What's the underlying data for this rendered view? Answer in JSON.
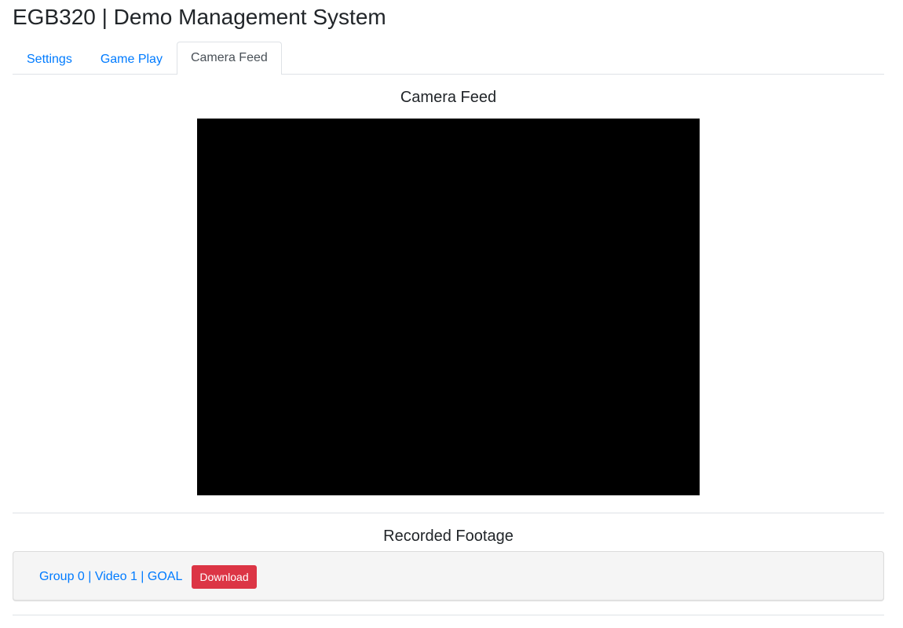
{
  "header": {
    "title": "EGB320 | Demo Management System"
  },
  "tabs": [
    {
      "label": "Settings",
      "active": false
    },
    {
      "label": "Game Play",
      "active": false
    },
    {
      "label": "Camera Feed",
      "active": true
    }
  ],
  "camera": {
    "heading": "Camera Feed",
    "feed_color": "#000000"
  },
  "footage": {
    "heading": "Recorded Footage",
    "items": [
      {
        "label": "Group 0 | Video 1 | GOAL",
        "download_label": "Download"
      }
    ]
  },
  "colors": {
    "link": "#007bff",
    "danger": "#dc3545",
    "border": "#dee2e6"
  }
}
